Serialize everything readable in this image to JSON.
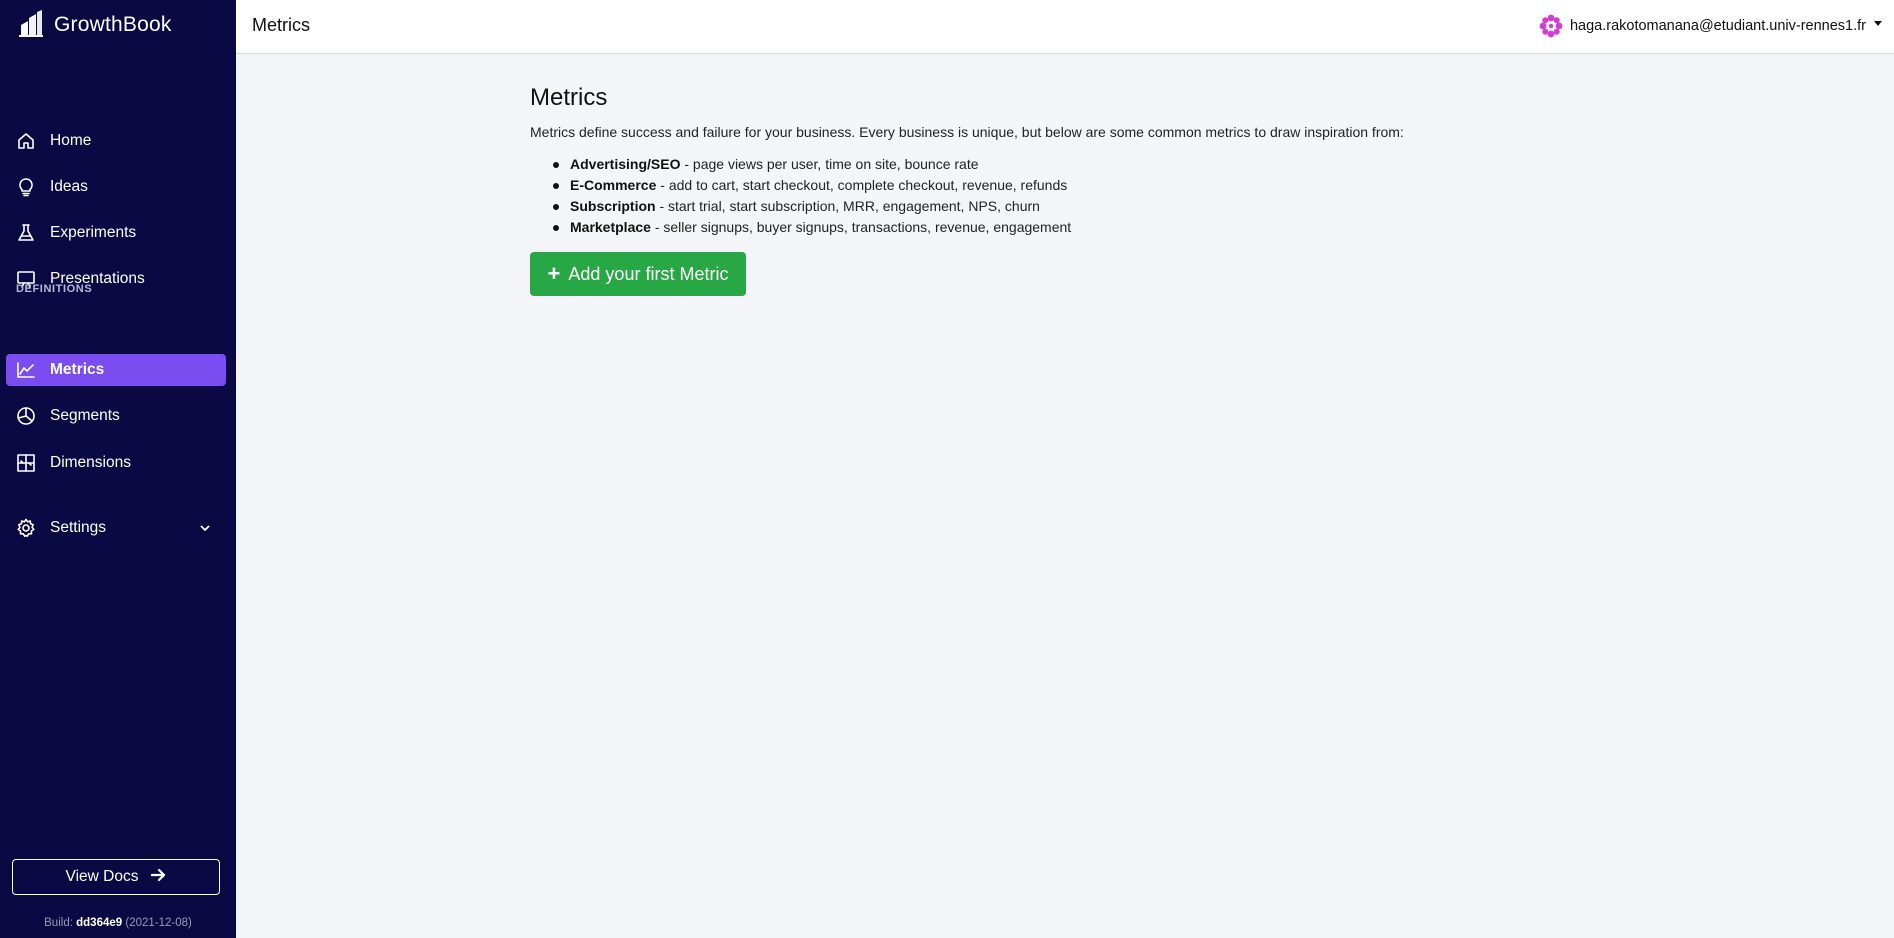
{
  "brand": {
    "name": "GrowthBook"
  },
  "sidebar": {
    "items": [
      {
        "label": "Home",
        "icon": "home-icon"
      },
      {
        "label": "Ideas",
        "icon": "lightbulb-icon"
      },
      {
        "label": "Experiments",
        "icon": "flask-icon"
      },
      {
        "label": "Presentations",
        "icon": "presentation-icon"
      }
    ],
    "section_label": "DEFINITIONS",
    "definitions": [
      {
        "label": "Metrics",
        "icon": "chart-line-icon",
        "active": true
      },
      {
        "label": "Segments",
        "icon": "pie-chart-icon"
      },
      {
        "label": "Dimensions",
        "icon": "grid-icon"
      }
    ],
    "settings": {
      "label": "Settings",
      "icon": "gear-icon"
    },
    "docs_button": "View Docs",
    "build": {
      "prefix": "Build:",
      "hash": "dd364e9",
      "date": "(2021-12-08)"
    }
  },
  "topbar": {
    "title": "Metrics",
    "user_email": "haga.rakotomanana@etudiant.univ-rennes1.fr"
  },
  "main": {
    "title": "Metrics",
    "intro": "Metrics define success and failure for your business. Every business is unique, but below are some common metrics to draw inspiration from:",
    "examples": [
      {
        "name": "Advertising/SEO",
        "desc": " - page views per user, time on site, bounce rate"
      },
      {
        "name": "E-Commerce",
        "desc": " - add to cart, start checkout, complete checkout, revenue, refunds"
      },
      {
        "name": "Subscription",
        "desc": " - start trial, start subscription, MRR, engagement, NPS, churn"
      },
      {
        "name": "Marketplace",
        "desc": " - seller signups, buyer signups, transactions, revenue, engagement"
      }
    ],
    "add_button": "Add your first Metric"
  },
  "colors": {
    "sidebar_bg": "#0a0943",
    "active_item": "#7b4cf0",
    "primary_button": "#28a745",
    "content_bg": "#f4f5f9",
    "avatar": "#d63bd6"
  }
}
